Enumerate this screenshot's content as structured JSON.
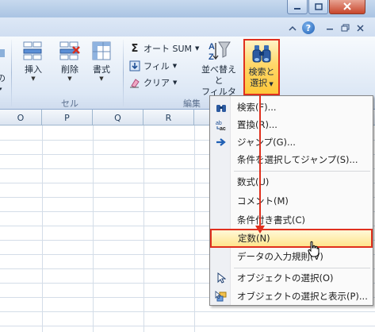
{
  "window": {
    "minimize_icon": "minimize-icon",
    "maximize_icon": "maximize-icon",
    "close_icon": "close-icon"
  },
  "ribbon_top": {
    "collapse_icon": "chevron-up-icon",
    "help_label": "?",
    "restore_icon": "restore-icon"
  },
  "ribbon": {
    "left_fragment": "の",
    "insert_label": "挿入",
    "delete_label": "削除",
    "format_label": "書式",
    "cells_group_label": "セル",
    "autosum_label": "オート SUM",
    "fill_label": "フィル",
    "clear_label": "クリア",
    "sort_label_1": "並べ替えと",
    "sort_label_2": "フィルター",
    "find_label_1": "検索と",
    "find_label_2": "選択",
    "editing_group_label": "編集"
  },
  "columns": [
    "O",
    "P",
    "Q",
    "R"
  ],
  "menu": {
    "items": [
      {
        "label": "検索(F)...",
        "icon": "binoculars-icon"
      },
      {
        "label": "置換(R)...",
        "icon": "replace-icon"
      },
      {
        "label": "ジャンプ(G)...",
        "icon": "arrow-right-icon"
      },
      {
        "label": "条件を選択してジャンプ(S)...",
        "icon": ""
      },
      {
        "label": "数式(U)",
        "icon": ""
      },
      {
        "label": "コメント(M)",
        "icon": ""
      },
      {
        "label": "条件付き書式(C)",
        "icon": ""
      },
      {
        "label": "定数(N)",
        "icon": ""
      },
      {
        "label": "データの入力規則(V)",
        "icon": ""
      },
      {
        "label": "オブジェクトの選択(O)",
        "icon": "cursor-icon"
      },
      {
        "label": "オブジェクトの選択と表示(P)...",
        "icon": "select-shapes-icon"
      }
    ]
  },
  "colors": {
    "highlight_border": "#e0301e",
    "highlight_fill": "#ffe58c",
    "ribbon_bg": "#dce7f5"
  }
}
